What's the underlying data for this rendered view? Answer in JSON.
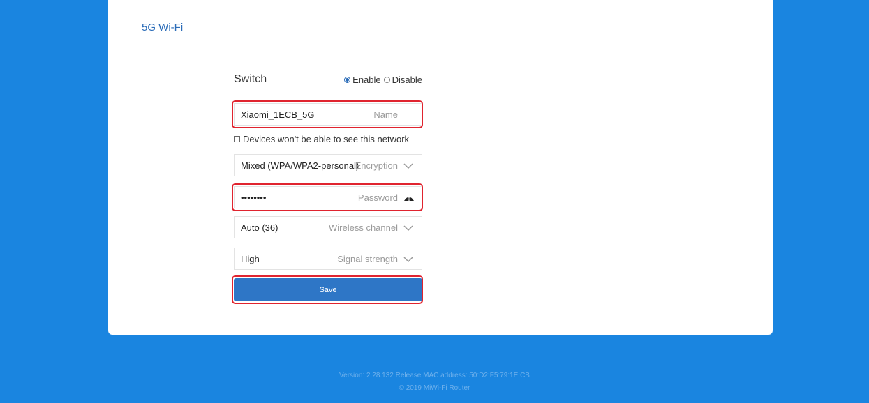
{
  "section": {
    "title": "5G Wi-Fi"
  },
  "switch": {
    "label": "Switch",
    "options": [
      {
        "label": "Enable",
        "selected": true
      },
      {
        "label": "Disable",
        "selected": false
      }
    ]
  },
  "name_field": {
    "value": "Xiaomi_1ECB_5G",
    "hint": "Name"
  },
  "hide_network": {
    "label": "Devices won't be able to see this network",
    "checked": false
  },
  "encryption_field": {
    "value": "Mixed (WPA/WPA2-personal)",
    "hint": "Encryption",
    "icon": "chevron-down-icon"
  },
  "password_field": {
    "value": "••••••••",
    "hint": "Password",
    "icon": "eye-icon"
  },
  "channel_field": {
    "value": "Auto (36)",
    "hint": "Wireless channel",
    "icon": "chevron-down-icon"
  },
  "signal_field": {
    "value": "High",
    "hint": "Signal strength",
    "icon": "chevron-down-icon"
  },
  "save": {
    "label": "Save"
  },
  "footer": {
    "version_line": "Version: 2.28.132 Release  MAC address: 50:D2:F5:79:1E:CB",
    "copyright": "© 2019 MiWi-Fi Router"
  },
  "colors": {
    "background": "#1a85e0",
    "accent": "#2b6cb8",
    "button": "#2e76c6",
    "highlight": "#e0242f"
  }
}
